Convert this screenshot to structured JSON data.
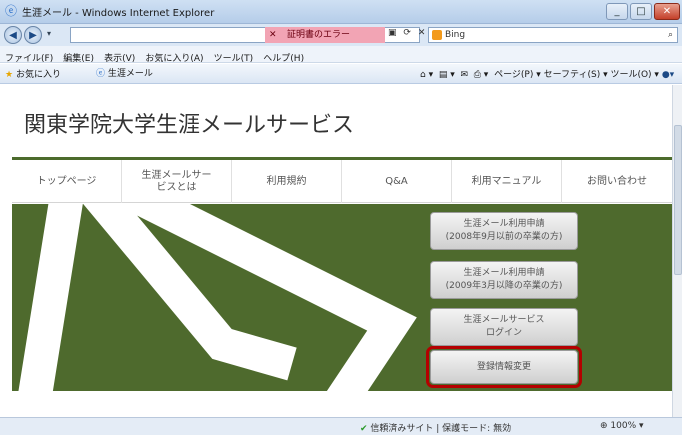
{
  "window": {
    "title": "生涯メール - Windows Internet Explorer",
    "controls": [
      "_",
      "□",
      "✕"
    ]
  },
  "addressbar": {
    "certificate_error": "証明書のエラー",
    "search_engine": "Bing"
  },
  "menubar": [
    "ファイル(F)",
    "編集(E)",
    "表示(V)",
    "お気に入り(A)",
    "ツール(T)",
    "ヘルプ(H)"
  ],
  "favbar": {
    "favorites": "お気に入り",
    "tab_label": "生涯メール",
    "tools": "ページ(P) ▾   セーフティ(S) ▾   ツール(O) ▾"
  },
  "page": {
    "title": "関東学院大学生涯メールサービス",
    "nav": [
      "トップページ",
      "生涯メールサービスとは",
      "利用規約",
      "Q&A",
      "利用マニュアル",
      "お問い合わせ"
    ],
    "buttons": [
      "生涯メール利用申請\n(2008年9月以前の卒業の方)",
      "生涯メール利用申請\n(2009年3月以降の卒業の方)",
      "生涯メールサービス\nログイン",
      "登録情報変更"
    ],
    "hero_color": "#4e6a2d",
    "highlight_color": "#b40000"
  },
  "statusbar": {
    "status": "信頼済みサイト | 保護モード: 無効",
    "zoom": "100%"
  }
}
